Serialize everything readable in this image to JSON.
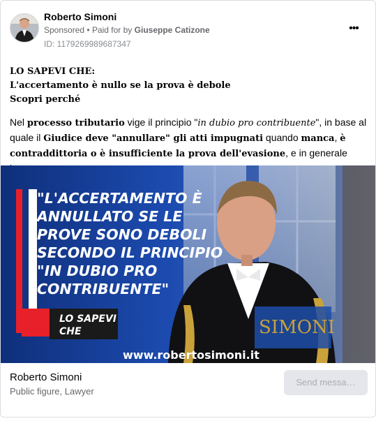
{
  "post": {
    "author": "Roberto Simoni",
    "sponsored": "Sponsored",
    "paid_prefix": "Paid for by",
    "paid_by": "Giuseppe Catizone",
    "ad_id": "ID: 1179269989687347",
    "more_label": "•••"
  },
  "body": {
    "line1": "LO SAPEVI CHE:",
    "line2": "L'accertamento è nullo se la prova è debole",
    "line3": "Scopri perché",
    "p_1": "Nel ",
    "p_2": "processo tributario",
    "p_3": " vige il principio \"",
    "p_4": "in dubio pro contribuente",
    "p_5": "\", in base al quale il ",
    "p_6": "Giudice deve \"annullare\" gli atti impugnati",
    "p_7": " quando ",
    "p_8": "manca",
    "p_9": ", ",
    "p_10": "è contraddittoria o è insufficiente la prova dell'evasione",
    "p_11": ", e in generale la…"
  },
  "media": {
    "quote": [
      "\"L'ACCERTAMENTO È",
      "ANNULLATO SE LE",
      "PROVE SONO DEBOLI",
      "SECONDO IL PRINCIPIO",
      "\"IN DUBIO PRO",
      "CONTRIBUENTE\""
    ],
    "badge_line1": "LO SAPEVI",
    "badge_line2": "CHE",
    "url": "www.robertosimoni.it",
    "logo": "SIMONI",
    "colors": {
      "red": "#e8202a",
      "blue": "#1f4aa3"
    }
  },
  "footer": {
    "page_name": "Roberto Simoni",
    "category": "Public figure, Lawyer",
    "send_label": "Send messa…"
  }
}
